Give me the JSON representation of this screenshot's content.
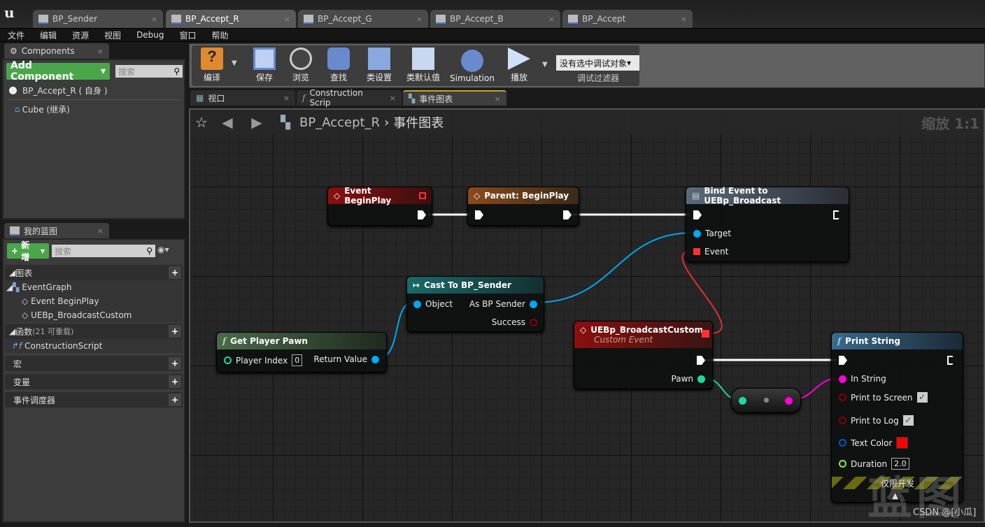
{
  "doc_tabs": [
    {
      "label": "BP_Sender"
    },
    {
      "label": "BP_Accept_R",
      "active": true
    },
    {
      "label": "BP_Accept_G"
    },
    {
      "label": "BP_Accept_B"
    },
    {
      "label": "BP_Accept"
    }
  ],
  "menu": [
    "文件",
    "编辑",
    "资源",
    "视图",
    "Debug",
    "窗口",
    "帮助"
  ],
  "components": {
    "tab": "Components",
    "add_label": "Add Component",
    "search_placeholder": "搜索",
    "items": [
      "BP_Accept_R ( 自身 )",
      "Cube (继承)"
    ]
  },
  "my_blueprint": {
    "tab": "我的蓝图",
    "add_label": "新增",
    "search_placeholder": "搜索",
    "graphs": {
      "label": "图表",
      "event_graph": "EventGraph",
      "events": [
        "Event BeginPlay",
        "UEBp_BroadcastCustom"
      ]
    },
    "functions": {
      "label": "函数",
      "note": "(21 可重载)",
      "items": [
        "ConstructionScript"
      ]
    },
    "macros": "宏",
    "variables": "变量",
    "dispatchers": "事件调度器"
  },
  "toolbar": {
    "compile": "编译",
    "save": "保存",
    "browse": "浏览",
    "find": "查找",
    "class_settings": "类设置",
    "class_defaults": "类默认值",
    "simulation": "Simulation",
    "play": "播放",
    "debug_object": "没有选中调试对象",
    "debug_filter": "调试过滤器"
  },
  "editor_tabs": [
    {
      "label": "视口"
    },
    {
      "label": "Construction Scrip"
    },
    {
      "label": "事件图表",
      "active": true
    }
  ],
  "graph": {
    "breadcrumb_root": "BP_Accept_R",
    "breadcrumb_current": "事件图表",
    "zoom": "缩放 1:1",
    "watermark": "蓝图",
    "credit": "CSDN @[小瓜]",
    "nodes": {
      "begin_play": {
        "title": "Event BeginPlay"
      },
      "parent_begin_play": {
        "title": "Parent: BeginPlay"
      },
      "bind_event": {
        "title": "Bind Event to UEBp_Broadcast",
        "pins": [
          "Target",
          "Event"
        ]
      },
      "cast": {
        "title": "Cast To BP_Sender",
        "pins": [
          "Object",
          "As BP Sender",
          "Success"
        ]
      },
      "get_player_pawn": {
        "title": "Get Player Pawn",
        "player_index_label": "Player Index",
        "player_index": "0",
        "return": "Return Value"
      },
      "custom_event": {
        "title": "UEBp_BroadcastCustom",
        "subtitle": "Custom Event",
        "pin": "Pawn"
      },
      "print_string": {
        "title": "Print String",
        "in_string": "In String",
        "print_to_screen": "Print to Screen",
        "print_to_screen_checked": true,
        "print_to_log": "Print to Log",
        "print_to_log_checked": true,
        "text_color": "Text Color",
        "text_color_value": "#ff0000",
        "duration": "Duration",
        "duration_value": "2.0",
        "dev_only": "仅限开发"
      }
    }
  },
  "colors": {
    "object_pin": "#00a8f0",
    "bool_pin": "#8b0000",
    "string_pin": "#ff00d4",
    "struct_pin": "#0058c8",
    "float_pin": "#8cf03c",
    "int_pin": "#1ed8a0",
    "delegate_pin": "#ff3838",
    "add_green": "#4aa64a"
  }
}
